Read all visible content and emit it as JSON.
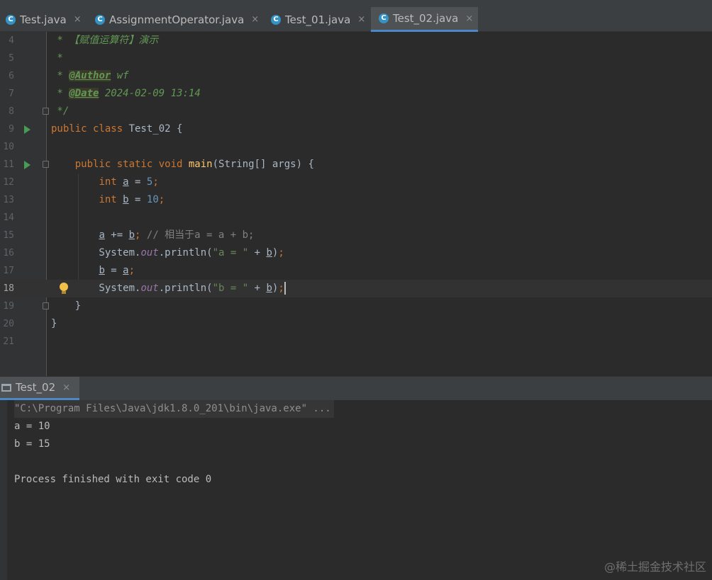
{
  "tabs": [
    {
      "label": "Test.java",
      "active": false
    },
    {
      "label": "AssignmentOperator.java",
      "active": false
    },
    {
      "label": "Test_01.java",
      "active": false
    },
    {
      "label": "Test_02.java",
      "active": true
    }
  ],
  "tab_close": "×",
  "tab_icon_glyph": "C",
  "editor": {
    "lines": [
      {
        "n": "4",
        "t": [
          {
            "c": "doc",
            "v": " * 【赋值运算符】演示"
          }
        ]
      },
      {
        "n": "5",
        "t": [
          {
            "c": "doc",
            "v": " *"
          }
        ]
      },
      {
        "n": "6",
        "t": [
          {
            "c": "doc",
            "v": " * "
          },
          {
            "c": "tag",
            "v": "@Author"
          },
          {
            "c": "doc",
            "v": " wf"
          }
        ]
      },
      {
        "n": "7",
        "t": [
          {
            "c": "doc",
            "v": " * "
          },
          {
            "c": "tag",
            "v": "@Date"
          },
          {
            "c": "doc",
            "v": " 2024-02-09 13:14"
          }
        ]
      },
      {
        "n": "8",
        "t": [
          {
            "c": "doc",
            "v": " */"
          }
        ]
      },
      {
        "n": "9",
        "t": [
          {
            "c": "kw",
            "v": "public class "
          },
          {
            "c": "",
            "v": "Test_02 {"
          }
        ]
      },
      {
        "n": "10",
        "t": []
      },
      {
        "n": "11",
        "t": [
          {
            "c": "",
            "v": "    "
          },
          {
            "c": "kw",
            "v": "public static void "
          },
          {
            "c": "fn",
            "v": "main"
          },
          {
            "c": "",
            "v": "(String[] args) {"
          }
        ]
      },
      {
        "n": "12",
        "t": [
          {
            "c": "",
            "v": "        "
          },
          {
            "c": "kw",
            "v": "int "
          },
          {
            "c": "u",
            "v": "a"
          },
          {
            "c": "",
            "v": " = "
          },
          {
            "c": "num",
            "v": "5"
          },
          {
            "c": "kw",
            "v": ";"
          }
        ]
      },
      {
        "n": "13",
        "t": [
          {
            "c": "",
            "v": "        "
          },
          {
            "c": "kw",
            "v": "int "
          },
          {
            "c": "u",
            "v": "b"
          },
          {
            "c": "",
            "v": " = "
          },
          {
            "c": "num",
            "v": "10"
          },
          {
            "c": "kw",
            "v": ";"
          }
        ]
      },
      {
        "n": "14",
        "t": []
      },
      {
        "n": "15",
        "t": [
          {
            "c": "",
            "v": "        "
          },
          {
            "c": "u",
            "v": "a"
          },
          {
            "c": "",
            "v": " += "
          },
          {
            "c": "u",
            "v": "b"
          },
          {
            "c": "kw",
            "v": "; "
          },
          {
            "c": "cmt",
            "v": "// 相当于a = a + b;"
          }
        ]
      },
      {
        "n": "16",
        "t": [
          {
            "c": "",
            "v": "        System."
          },
          {
            "c": "field",
            "v": "out"
          },
          {
            "c": "",
            "v": ".println("
          },
          {
            "c": "str",
            "v": "\"a = \""
          },
          {
            "c": "",
            "v": " + "
          },
          {
            "c": "u",
            "v": "b"
          },
          {
            "c": "",
            "v": ")"
          },
          {
            "c": "kw",
            "v": ";"
          }
        ]
      },
      {
        "n": "17",
        "t": [
          {
            "c": "",
            "v": "        "
          },
          {
            "c": "u",
            "v": "b"
          },
          {
            "c": "",
            "v": " = "
          },
          {
            "c": "u",
            "v": "a"
          },
          {
            "c": "kw",
            "v": ";"
          }
        ]
      },
      {
        "n": "18",
        "t": [
          {
            "c": "",
            "v": "        System."
          },
          {
            "c": "field",
            "v": "out"
          },
          {
            "c": "",
            "v": ".println("
          },
          {
            "c": "str",
            "v": "\"b = \""
          },
          {
            "c": "",
            "v": " + "
          },
          {
            "c": "u",
            "v": "b"
          },
          {
            "c": "",
            "v": ")"
          },
          {
            "c": "kw",
            "v": ";"
          },
          {
            "c": "caret",
            "v": ""
          }
        ]
      },
      {
        "n": "19",
        "t": [
          {
            "c": "",
            "v": "    }"
          }
        ]
      },
      {
        "n": "20",
        "t": [
          {
            "c": "",
            "v": "}"
          }
        ]
      },
      {
        "n": "21",
        "t": []
      }
    ]
  },
  "run": {
    "tab_label": "Test_02",
    "console": [
      "\"C:\\Program Files\\Java\\jdk1.8.0_201\\bin\\java.exe\" ...",
      "a = 10",
      "b = 15",
      "",
      "Process finished with exit code 0"
    ]
  },
  "watermark": "@稀土掘金技术社区",
  "colors": {
    "accent": "#4a88c7",
    "keyword": "#cc7832",
    "string": "#6a8759",
    "number": "#6897bb",
    "doc": "#629755"
  }
}
